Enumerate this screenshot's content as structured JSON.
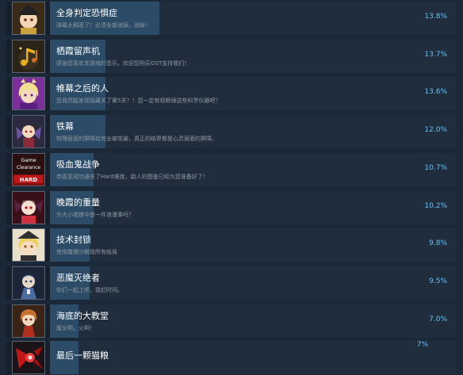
{
  "achievements": [
    {
      "title": "全身判定恐惧症",
      "desc": "弹幕太稠密了！必须全部消掉，消掉！",
      "percent": "13.8%",
      "fill": 0.138,
      "icon": "character-portrait-icon",
      "accent": "#c9a23a"
    },
    {
      "title": "栖霞留声机",
      "desc": "感谢您喜欢本游戏的音乐。欢迎您购买OST支持我们！",
      "percent": "13.7%",
      "fill": 0.137,
      "icon": "music-note-icon",
      "accent": "#d9a020"
    },
    {
      "title": "帷幕之后的人",
      "desc": "您竟然能发现隐藏关了第5关？！您一定有视眼镜这些科学仪器吧？",
      "percent": "13.6%",
      "fill": 0.136,
      "icon": "character-portrait-icon",
      "accent": "#8e3fb0"
    },
    {
      "title": "铁幕",
      "desc": "物理层面的屏障给完全被攻破，真正的结界都是心灵层面的屏障。",
      "percent": "12.0%",
      "fill": 0.12,
      "icon": "character-portrait-icon",
      "accent": "#7a5aa8"
    },
    {
      "title": "吸血鬼战争",
      "desc": "恭喜您成功通关了Hard难度，敌人的图鉴已经为您准备好了！",
      "percent": "10.7%",
      "fill": 0.107,
      "icon": "game-clearance-hard-icon",
      "accent": "#b02828"
    },
    {
      "title": "晚霞的重量",
      "desc": "为大小姐撑伞是一件浪漫事吗？",
      "percent": "10.2%",
      "fill": 0.102,
      "icon": "character-portrait-icon",
      "accent": "#c0303a"
    },
    {
      "title": "技术封锁",
      "desc": "使用魔理沙解锁所有结局",
      "percent": "9.8%",
      "fill": 0.098,
      "icon": "character-portrait-icon",
      "accent": "#d8c070"
    },
    {
      "title": "恶魔灭绝者",
      "desc": "你们一起上吧，我赶时间。",
      "percent": "9.5%",
      "fill": 0.095,
      "icon": "character-portrait-icon",
      "accent": "#4a6aa0"
    },
    {
      "title": "海底的大教堂",
      "desc": "魔女啊，火啊！",
      "percent": "7.0%",
      "fill": 0.07,
      "icon": "character-portrait-icon",
      "accent": "#c08040"
    },
    {
      "title": "最后一颗猫粮",
      "desc": "",
      "percent": "7%",
      "fill": 0.07,
      "icon": "character-portrait-icon",
      "accent": "#c02020"
    }
  ]
}
